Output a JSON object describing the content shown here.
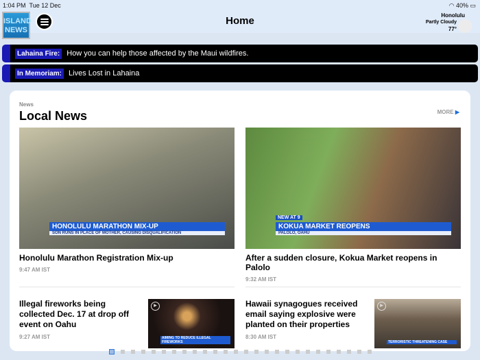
{
  "status": {
    "time": "1:04 PM",
    "date": "Tue 12 Dec",
    "battery": "40%"
  },
  "header": {
    "logo": "ISLAND NEWS",
    "title": "Home",
    "weather": {
      "city": "Honolulu",
      "condition": "Partly Cloudy",
      "temp": "77°"
    }
  },
  "tickers": [
    {
      "tag": "Lahaina Fire:",
      "text": "How you can help those affected by the Maui wildfires."
    },
    {
      "tag": "In Memoriam:",
      "text": "Lives Lost in Lahaina"
    }
  ],
  "section": {
    "kicker": "News",
    "title": "Local News",
    "more": "MORE"
  },
  "featured": [
    {
      "headline": "Honolulu Marathon Registration Mix-up",
      "time": "9:47 AM IST",
      "banner_top": "",
      "banner_main": "HONOLULU MARATHON MIX-UP",
      "banner_sub": "SON RUNS IN PLACE OF MOTHER, CAUSING DISQUALIFICATION"
    },
    {
      "headline": "After a sudden closure, Kokua Market reopens in Palolo",
      "time": "9:32 AM IST",
      "banner_top": "NEW AT 9",
      "banner_main": "KOKUA MARKET REOPENS",
      "banner_sub": "PALOLO, OAHU"
    }
  ],
  "stories": [
    {
      "headline": "Illegal fireworks being collected Dec. 17 at drop off event on Oahu",
      "time": "9:27 AM IST",
      "banner": "AIMING TO REDUCE ILLEGAL FIREWORKS"
    },
    {
      "headline": "Hawaii synagogues received email saying explosive were planted on their properties",
      "time": "8:30 AM IST",
      "banner": "TERRORISTIC THREATENING CASE"
    }
  ],
  "pager": {
    "total": 26,
    "current": 1
  }
}
